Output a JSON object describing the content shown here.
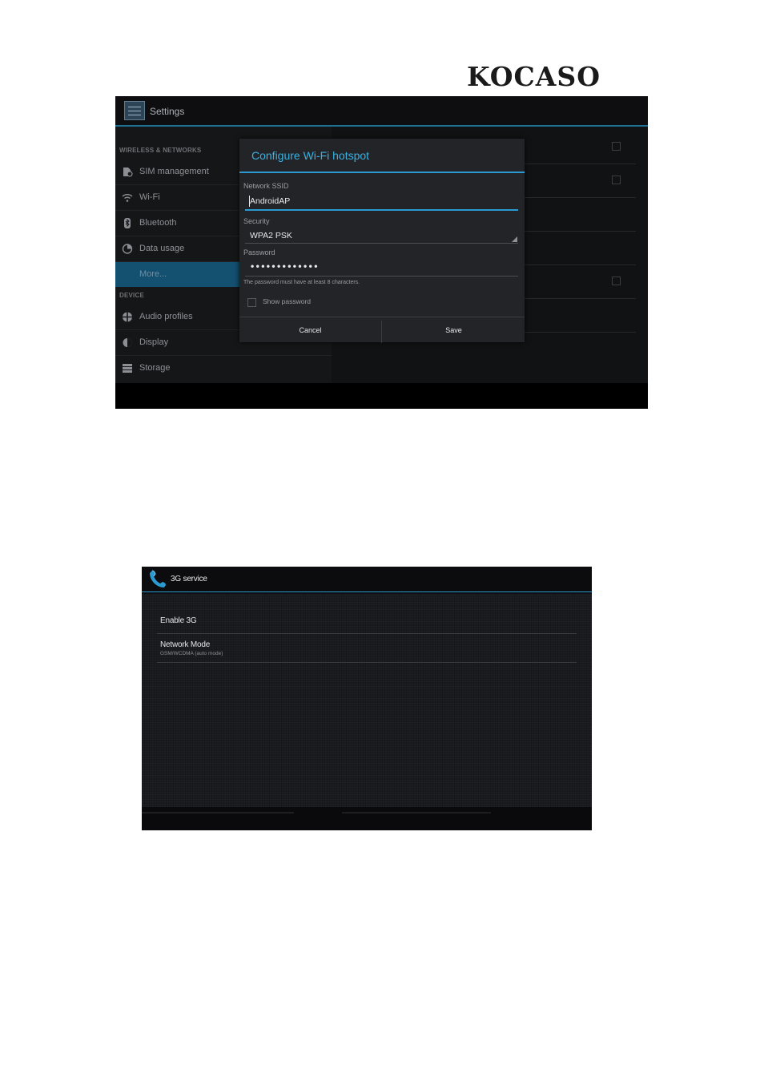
{
  "logo": {
    "text": "KOCASO"
  },
  "settings_screen": {
    "action_bar": {
      "title": "Settings",
      "icon": "settings-app-icon"
    },
    "sections": [
      {
        "header": "WIRELESS & NETWORKS",
        "items": [
          {
            "label": "SIM management",
            "icon": "sim-card-icon"
          },
          {
            "label": "Wi-Fi",
            "icon": "wifi-icon"
          },
          {
            "label": "Bluetooth",
            "icon": "bluetooth-icon"
          },
          {
            "label": "Data usage",
            "icon": "data-usage-icon"
          },
          {
            "label": "More...",
            "selected": true
          }
        ]
      },
      {
        "header": "DEVICE",
        "items": [
          {
            "label": "Audio profiles",
            "icon": "audio-profiles-icon"
          },
          {
            "label": "Display",
            "icon": "display-brightness-icon"
          },
          {
            "label": "Storage",
            "icon": "storage-icon"
          }
        ]
      }
    ],
    "dialog": {
      "title": "Configure Wi-Fi hotspot",
      "ssid_label": "Network SSID",
      "ssid_value": "AndroidAP",
      "security_label": "Security",
      "security_value": "WPA2 PSK",
      "password_label": "Password",
      "password_mask": "•••••••••••••",
      "password_hint": "The password must have at least 8 characters.",
      "show_password_label": "Show password",
      "show_password_checked": false,
      "cancel_label": "Cancel",
      "save_label": "Save"
    }
  },
  "service_screen": {
    "action_bar": {
      "title": "3G service",
      "icon": "phone-icon"
    },
    "items": [
      {
        "title": "Enable 3G",
        "summary": ""
      },
      {
        "title": "Network Mode",
        "summary": "GSM/WCDMA (auto mode)"
      }
    ]
  },
  "colors": {
    "accent_blue": "#2a9ad0",
    "dialog_title": "#3ab1e2",
    "selected_item": "#145070"
  }
}
